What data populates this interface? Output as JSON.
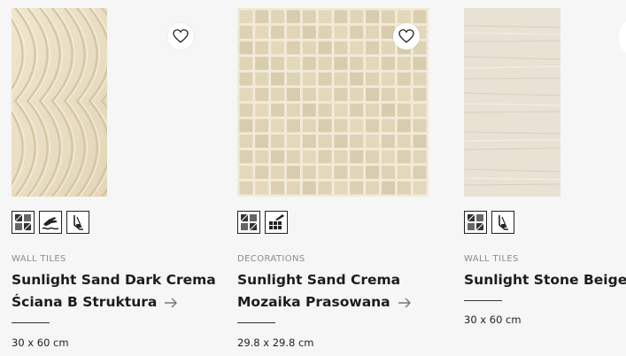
{
  "products": [
    {
      "category": "WALL TILES",
      "name_line1": "Sunlight Sand Dark Crema",
      "name_line2": "Ściana B Struktura",
      "size": "30 x 60 cm",
      "icons": [
        "wall-floor-tiles-icon",
        "hand-wave-icon",
        "finger-touch-icon"
      ]
    },
    {
      "category": "DECORATIONS",
      "name_line1": "Sunlight Sand Crema",
      "name_line2": "Mozaika Prasowana",
      "size": "29.8 x 29.8 cm",
      "icons": [
        "wall-floor-tiles-icon",
        "mosaic-icon"
      ]
    },
    {
      "category": "WALL TILES",
      "name_line1": "Sunlight Stone Beige",
      "size": "30 x 60 cm",
      "icons": [
        "wall-floor-tiles-icon",
        "finger-touch-icon"
      ]
    }
  ],
  "colors": {
    "background": "#f6f6f6",
    "tile_sand": "#ece3cb",
    "tile_stone": "#e8e2d4",
    "text": "#1c1c1c",
    "muted": "#8c8c8c"
  }
}
